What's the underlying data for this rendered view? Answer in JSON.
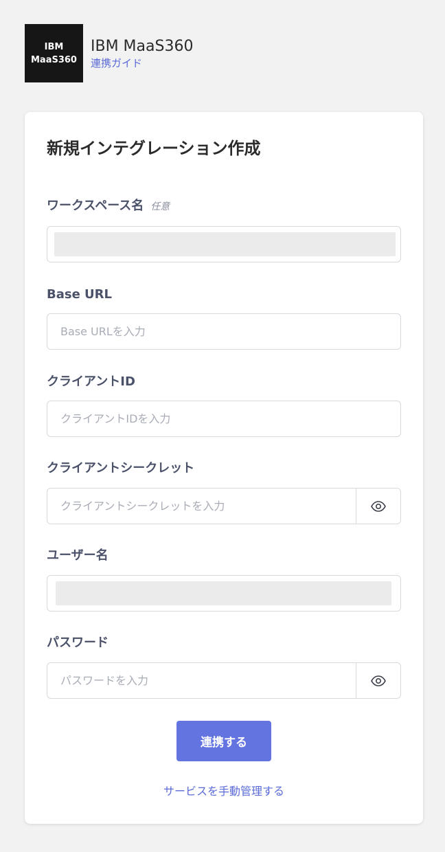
{
  "header": {
    "logo_line1": "IBM",
    "logo_line2": "MaaS360",
    "app_name": "IBM MaaS360",
    "guide_link": "連携ガイド"
  },
  "form": {
    "title": "新規インテグレーション作成",
    "workspace": {
      "label": "ワークスペース名",
      "optional_tag": "任意",
      "value": "",
      "prefilled_masked": true
    },
    "base_url": {
      "label": "Base URL",
      "placeholder": "Base URLを入力"
    },
    "client_id": {
      "label": "クライアントID",
      "placeholder": "クライアントIDを入力"
    },
    "client_secret": {
      "label": "クライアントシークレット",
      "placeholder": "クライアントシークレットを入力",
      "toggle_icon": "eye-icon"
    },
    "username": {
      "label": "ユーザー名",
      "value": "",
      "prefilled_masked": true
    },
    "password": {
      "label": "パスワード",
      "placeholder": "パスワードを入力",
      "toggle_icon": "eye-icon"
    },
    "submit_label": "連携する",
    "manual_link": "サービスを手動管理する"
  },
  "colors": {
    "background": "#f2f2f2",
    "card": "#ffffff",
    "accent": "#6374e0",
    "link": "#5a6bd8",
    "label": "#4a5169",
    "logo_bg": "#161616"
  }
}
